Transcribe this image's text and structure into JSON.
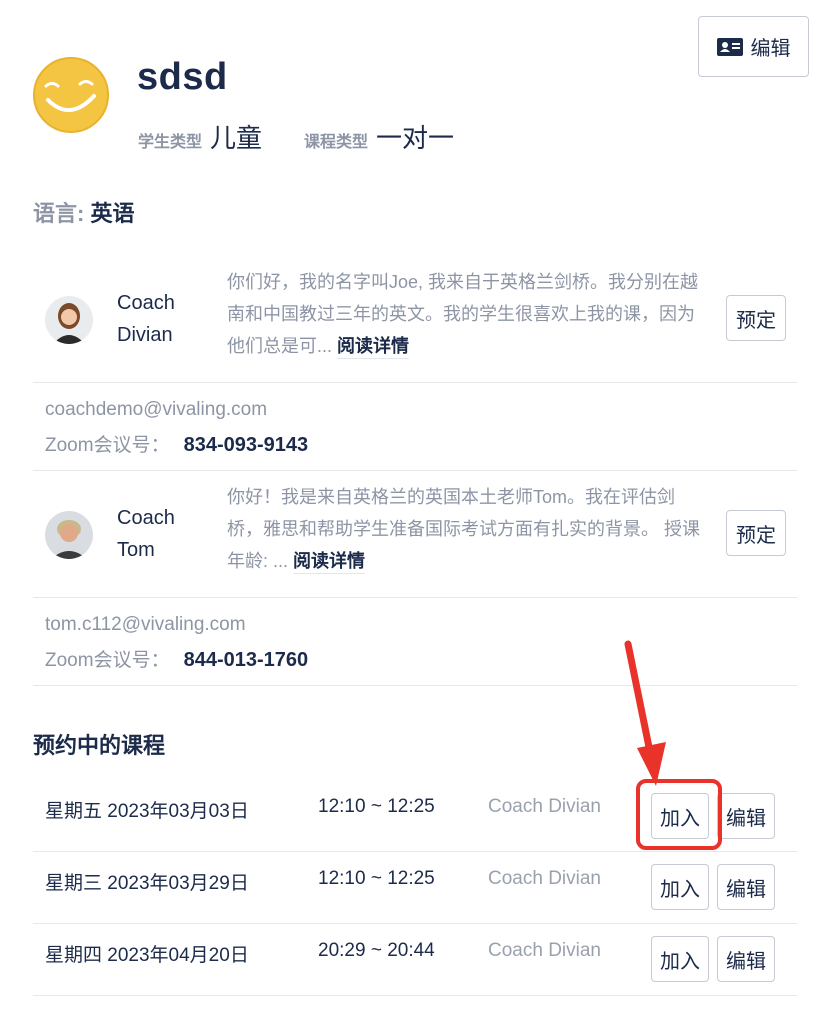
{
  "student": {
    "name": "sdsd",
    "student_type_label": "学生类型",
    "student_type_value": "儿童",
    "course_type_label": "课程类型",
    "course_type_value": "一对一"
  },
  "header": {
    "edit_label": "编辑"
  },
  "language": {
    "label": "语言:",
    "value": "英语"
  },
  "coaches": [
    {
      "name_line1": "Coach",
      "name_line2": "Divian",
      "bio": "你们好，我的名字叫Joe, 我来自于英格兰剑桥。我分别在越南和中国教过三年的英文。我的学生很喜欢上我的课，因为他们总是可...",
      "read_more": "阅读详情",
      "book_label": "预定",
      "email": "coachdemo@vivaling.com",
      "zoom_label": "Zoom会议号：",
      "zoom_number": "834-093-9143"
    },
    {
      "name_line1": "Coach",
      "name_line2": "Tom",
      "bio": "你好！我是来自英格兰的英国本土老师Tom。我在评估剑桥，雅思和帮助学生准备国际考试方面有扎实的背景。 授课年龄: ...",
      "read_more": "阅读详情",
      "book_label": "预定",
      "email": "tom.c112@vivaling.com",
      "zoom_label": "Zoom会议号：",
      "zoom_number": "844-013-1760"
    }
  ],
  "upcoming": {
    "title": "预约中的课程",
    "lessons": [
      {
        "date": "星期五 2023年03月03日",
        "time": "12:10 ~ 12:25",
        "coach": "Coach Divian",
        "join_label": "加入",
        "edit_label": "编辑"
      },
      {
        "date": "星期三 2023年03月29日",
        "time": "12:10 ~ 12:25",
        "coach": "Coach Divian",
        "join_label": "加入",
        "edit_label": "编辑"
      },
      {
        "date": "星期四 2023年04月20日",
        "time": "20:29 ~ 20:44",
        "coach": "Coach Divian",
        "join_label": "加入",
        "edit_label": "编辑"
      }
    ]
  },
  "colors": {
    "primary_text": "#1c2b4a",
    "muted_text": "#8d95a5",
    "highlight": "#e8322a",
    "avatar_yellow": "#f4c542"
  }
}
